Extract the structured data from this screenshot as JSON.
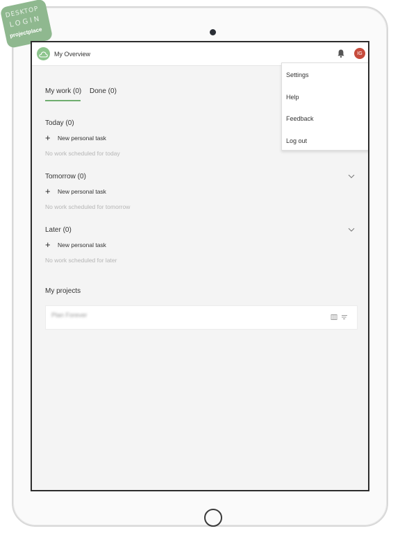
{
  "sticker": {
    "line1": "DESKTOP",
    "line2": "LOGIN",
    "brand": "projectplace"
  },
  "header": {
    "title": "My Overview",
    "avatar_initials": "IG"
  },
  "user_menu": {
    "items": [
      "Settings",
      "Help",
      "Feedback",
      "Log out"
    ]
  },
  "tabs": [
    {
      "label": "My work (0)",
      "active": true
    },
    {
      "label": "Done (0)",
      "active": false
    }
  ],
  "sections": [
    {
      "title": "Today (0)",
      "add_label": "New personal task",
      "empty_text": "No work scheduled for today",
      "collapsible": false
    },
    {
      "title": "Tomorrow (0)",
      "add_label": "New personal task",
      "empty_text": "No work scheduled for tomorrow",
      "collapsible": true
    },
    {
      "title": "Later (0)",
      "add_label": "New personal task",
      "empty_text": "No work scheduled for later",
      "collapsible": true
    }
  ],
  "projects": {
    "title": "My projects",
    "items": [
      {
        "name": "Plan Forever"
      }
    ]
  },
  "colors": {
    "accent": "#6fae6f",
    "avatar": "#c64b3c",
    "screen_bg": "#f4f4f4"
  },
  "icons": [
    "bell-icon",
    "chevron-down-icon",
    "plus-icon",
    "board-icon",
    "list-icon",
    "cloud-logo-icon",
    "camera-icon",
    "home-button"
  ]
}
